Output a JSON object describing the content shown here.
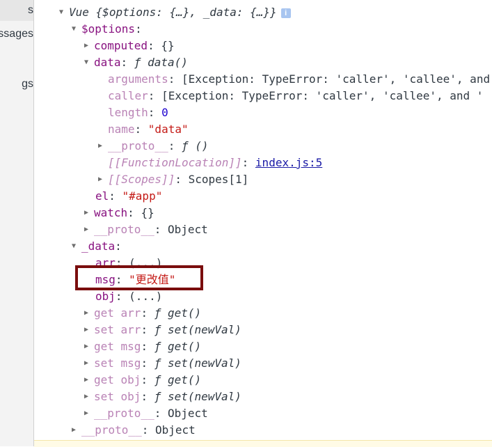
{
  "sidebar": {
    "items": [
      {
        "label": "s"
      },
      {
        "label": "ssages"
      },
      {
        "label": "gs"
      }
    ]
  },
  "tree": {
    "root_label": "Vue",
    "root_summary": "{$options: {…}, _data: {…}}",
    "options_key": "$options",
    "computed_key": "computed",
    "computed_value": "{}",
    "data_key": "data",
    "data_value": "ƒ data()",
    "arguments_key": "arguments",
    "arguments_value": "[Exception: TypeError: 'caller', 'callee', and",
    "caller_key": "caller",
    "caller_value": "[Exception: TypeError: 'caller', 'callee', and '",
    "length_key": "length",
    "length_value": "0",
    "name_key": "name",
    "name_value": "\"data\"",
    "proto_fn_key": "__proto__",
    "proto_fn_value": "ƒ ()",
    "function_location_key": "[[FunctionLocation]]",
    "function_location_link": "index.js:5",
    "scopes_key": "[[Scopes]]",
    "scopes_value": "Scopes[1]",
    "el_key": "el",
    "el_value": "\"#app\"",
    "watch_key": "watch",
    "watch_value": "{}",
    "proto_options_key": "__proto__",
    "proto_options_value": "Object",
    "data_underscore_key": "_data",
    "arr_key": "arr",
    "arr_value": "(...)",
    "msg_key": "msg",
    "msg_value": "\"更改值\"",
    "obj_key": "obj",
    "obj_value": "(...)",
    "get_arr_key": "get arr",
    "get_arr_value": "ƒ get()",
    "set_arr_key": "set arr",
    "set_arr_value": "ƒ set(newVal)",
    "get_msg_key": "get msg",
    "get_msg_value": "ƒ get()",
    "set_msg_key": "set msg",
    "set_msg_value": "ƒ set(newVal)",
    "get_obj_key": "get obj",
    "get_obj_value": "ƒ get()",
    "set_obj_key": "set obj",
    "set_obj_value": "ƒ set(newVal)",
    "proto_data_key": "__proto__",
    "proto_data_value": "Object",
    "proto_root_key": "__proto__",
    "proto_root_value": "Object",
    "info_icon_text": "i"
  },
  "colors": {
    "key": "#881280",
    "key_dim": "#b982b5",
    "string": "#c41a16",
    "number": "#1c00cf",
    "highlight_border": "#7a0d0d"
  }
}
